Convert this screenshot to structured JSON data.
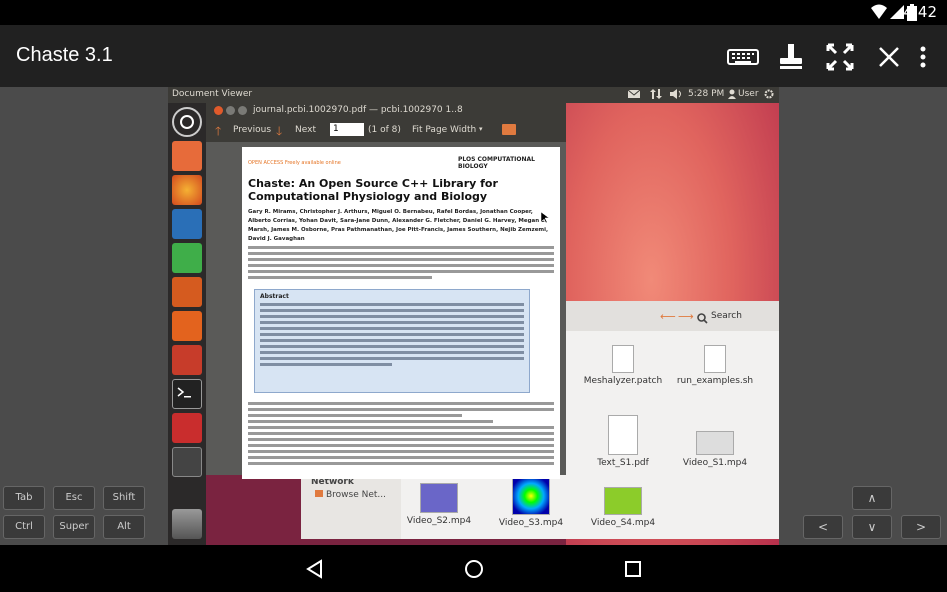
{
  "status": {
    "time": "4:42"
  },
  "app": {
    "title": "Chaste 3.1"
  },
  "desktop": {
    "panel_title": "Document Viewer",
    "clock": "5:28 PM",
    "user": "User"
  },
  "docviewer": {
    "title": "journal.pcbi.1002970.pdf — pcbi.1002970 1..8",
    "prev_label": "Previous",
    "next_label": "Next",
    "page_value": "1",
    "page_of": "(1 of 8)",
    "zoom": "Fit Page Width"
  },
  "paper": {
    "open_access": "OPEN ACCESS Freely available online",
    "journal": "PLOS COMPUTATIONAL BIOLOGY",
    "title": "Chaste: An Open Source C++ Library for Computational Physiology and Biology",
    "authors": "Gary R. Mirams, Christopher J. Arthurs, Miguel O. Bernabeu, Rafel Bordas, Jonathan Cooper, Alberto Corrias, Yohan Davit, Sara-Jane Dunn, Alexander G. Fletcher, Daniel G. Harvey, Megan E. Marsh, James M. Osborne, Pras Pathmanathan, Joe Pitt-Francis, James Southern, Nejib Zemzemi, David J. Gavaghan",
    "abstract_heading": "Abstract"
  },
  "files": {
    "search_label": "Search",
    "network_label": "Network",
    "browse_label": "Browse Net...",
    "items": [
      {
        "name": "Meshalyzer.patch"
      },
      {
        "name": "run_examples.sh"
      },
      {
        "name": "Text_S1.pdf"
      },
      {
        "name": "Video_S1.mp4"
      },
      {
        "name": "Video_S2.mp4"
      },
      {
        "name": "Video_S3.mp4"
      },
      {
        "name": "Video_S4.mp4"
      }
    ]
  },
  "keys": {
    "tab": "Tab",
    "esc": "Esc",
    "shift": "Shift",
    "ctrl": "Ctrl",
    "super": "Super",
    "alt": "Alt"
  },
  "arrows": {
    "up": "∧",
    "left": "<",
    "down": "∨",
    "right": ">"
  }
}
